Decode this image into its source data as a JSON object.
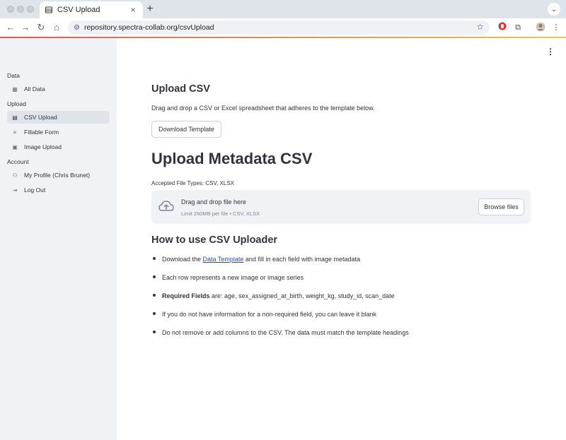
{
  "browser": {
    "tab_title": "CSV Upload",
    "tab_close": "×",
    "new_tab": "+",
    "url": "repository.spectra-collab.org/csvUpload",
    "icons": [
      "back-icon",
      "forward-icon",
      "reload-icon",
      "home-icon",
      "site-info-icon",
      "star-icon",
      "extension-icon",
      "puzzle-icon",
      "profile-icon",
      "menu-icon"
    ]
  },
  "sidebar": {
    "sections": [
      {
        "label": "Data",
        "items": [
          {
            "label": "All Data",
            "icon": "table-icon"
          }
        ]
      },
      {
        "label": "Upload",
        "items": [
          {
            "label": "CSV Upload",
            "icon": "csv-icon",
            "active": true
          },
          {
            "label": "Fillable Form",
            "icon": "form-icon"
          },
          {
            "label": "Image Upload",
            "icon": "image-icon"
          }
        ]
      },
      {
        "label": "Account",
        "items": [
          {
            "label": "My Profile (Chris Brunet)",
            "icon": "person-icon"
          },
          {
            "label": "Log Out",
            "icon": "logout-icon"
          }
        ]
      }
    ]
  },
  "main": {
    "upload_title": "Upload CSV",
    "upload_desc": "Drag and drop a CSV or Excel spreadsheet that adheres to the template below.",
    "download_button": "Download Template",
    "metadata_title": "Upload Metadata CSV",
    "accepted_types": "Accepted File Types: CSV, XLSX",
    "dropzone": {
      "title": "Drag and drop file here",
      "limit": "Limit 260MB per file • CSV, XLSX",
      "browse_button": "Browse files"
    },
    "howto_title": "How to use CSV Uploader",
    "bullets": {
      "b1_pre": "Download the ",
      "b1_link": "Data Template",
      "b1_post": " and fill in each field with image metadata",
      "b2": "Each row represents a new image or image series",
      "b3_bold": "Required Fields",
      "b3_rest": " are: age, sex_assigned_at_birth, weight_kg, study_id, scan_date",
      "b4": "If you do not have information for a non-required field, you can leave it blank",
      "b5": "Do not remove or add columns to the CSV. The data must match the template headings"
    }
  },
  "colors": {
    "accent": "#ff4b4b",
    "link": "#1c4ec4",
    "sidebar_bg": "#f0f2f6",
    "text": "#31333f"
  }
}
